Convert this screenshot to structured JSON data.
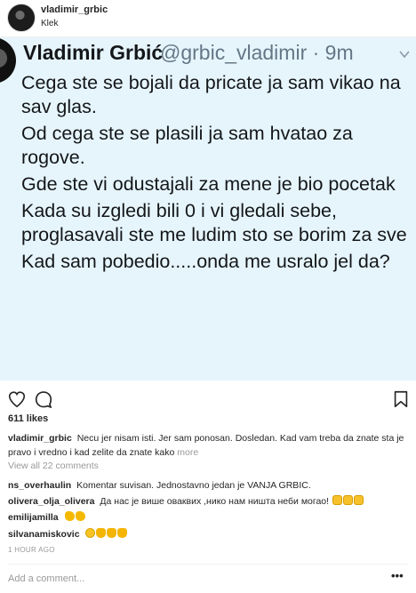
{
  "post": {
    "username": "vladimir_grbic",
    "location": "Klek"
  },
  "tweet": {
    "name": "Vladimir Grbić",
    "handle_time": "@grbic_vladimir · 9m",
    "lines": [
      "Cega ste se bojali da pricate ja sam vikao na sav glas.",
      "Od cega ste se plasili ja sam hvatao za rogove.",
      "Gde ste vi odustajali za mene je bio pocetak",
      "Kada su izgledi bili 0 i vi gledali sebe, proglasavali ste me ludim sto se borim za sve",
      "Kad sam pobedio.....onda me usralo jel da?"
    ]
  },
  "actions": {
    "like_icon": "heart-icon",
    "comment_icon": "comment-icon",
    "save_icon": "bookmark-icon"
  },
  "likes": "611 likes",
  "caption": {
    "user": "vladimir_grbic",
    "text": "Necu jer nisam isti. Jer sam ponosan. Dosledan. Kad vam treba da znate sta je pravo i vredno i kad zelite da znate kako",
    "more": "more"
  },
  "view_all": "View all 22 comments",
  "comments": [
    {
      "user": "ns_overhaulin",
      "text": "Komentar suvisan. Jednostavno jedan je VANJA GRBIC."
    },
    {
      "user": "olivera_olja_olivera",
      "text": "Да нас је више оваквих ,нико нам ништа неби могао!"
    },
    {
      "user": "emilijamilla",
      "text": ""
    },
    {
      "user": "silvanamiskovic",
      "text": ""
    }
  ],
  "timestamp": "1 HOUR AGO",
  "add_comment_placeholder": "Add a comment...",
  "options_label": "•••",
  "colors": {
    "tweet_background": "#e6f5fc",
    "tweet_text": "#14171a",
    "tweet_handle": "#657786",
    "muted_text": "#999999"
  }
}
